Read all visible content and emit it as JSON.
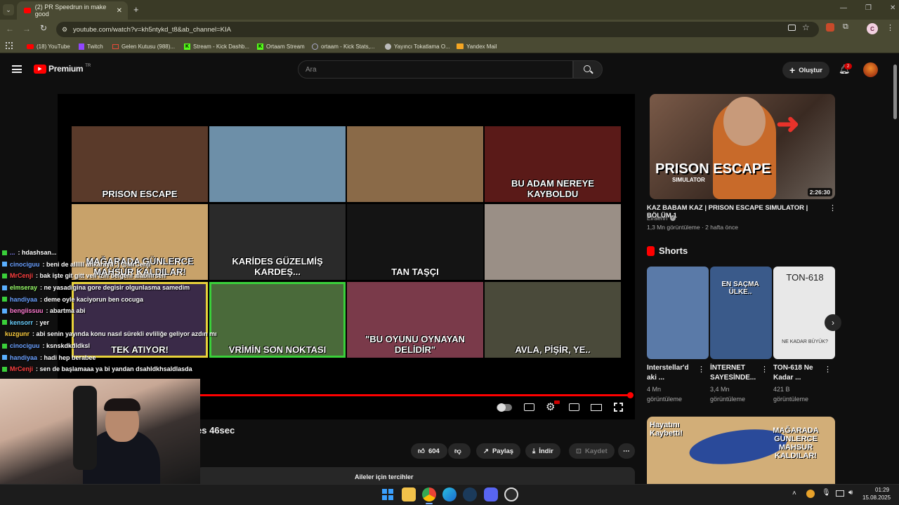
{
  "browser": {
    "tab_title": "(2) PR Speedrun in make good",
    "url": "youtube.com/watch?v=kh5ntykd_t8&ab_channel=KIA",
    "profile_letter": "C",
    "bookmarks": [
      "(18) YouTube",
      "Twitch",
      "Gelen Kutusu (988)...",
      "Stream - Kick Dashb...",
      "Ortaam Stream",
      "ortaam - Kick Stats,...",
      "Yayıncı Tokatlama O...",
      "Yandex Mail"
    ]
  },
  "youtube": {
    "logo": "Premium",
    "logo_sup": "TR",
    "search_placeholder": "Ara",
    "create_label": "Oluştur",
    "notif_count": "2"
  },
  "grid_thumbs": [
    {
      "caption": "PRISON ESCAPE",
      "bg": "#5a3a2a"
    },
    {
      "caption": "",
      "bg": "#6d8fa8"
    },
    {
      "caption": "",
      "bg": "#8a6a48"
    },
    {
      "caption": "BU ADAM NEREYE KAYBOLDU",
      "bg": "#5a1a18"
    },
    {
      "caption": "MAĞARADA GÜNLERCE MAHSUR KALDILAR!",
      "bg": "#c8a26a"
    },
    {
      "caption": "KARİDES GÜZELMİŞ KARDEŞ...",
      "bg": "#2a2a2a"
    },
    {
      "caption": "TAN TAŞÇI",
      "bg": "#141414"
    },
    {
      "caption": "",
      "bg": "#9a8f86"
    },
    {
      "caption": "TEK ATIYOR!",
      "bg": "#3a2a48"
    },
    {
      "caption": "VRİMİN SON NOKTASI",
      "bg": "#4a6a3a"
    },
    {
      "caption": "\"BU OYUNU OYNAYAN DELİDİR\"",
      "bg": "#7a3a4a"
    },
    {
      "caption": "AVLA, PİŞİR, YE..",
      "bg": "#4a4a3a"
    }
  ],
  "chat": [
    {
      "user": "...",
      "text": ": hdashsan...",
      "color": "#8a8aff"
    },
    {
      "user": "cinociguu",
      "text": ": beni de allllll ankaraya :) @MrCenji",
      "color": "#6aa0ff"
    },
    {
      "user": "MrCenji",
      "text": ": bak işte git gitt veli izin belgeni alabilirsen",
      "color": "#ff4040"
    },
    {
      "user": "elmseray",
      "text": ": ne yasadigina gore degisir olgunlasma samedim",
      "color": "#9aff6a"
    },
    {
      "user": "handiyaa",
      "text": ": deme oyle kaciyorun ben cocuga",
      "color": "#6aa0ff"
    },
    {
      "user": "bengiissuu",
      "text": ": abartma abi",
      "color": "#ff7ad0"
    },
    {
      "user": "kensorr",
      "text": ": yer",
      "color": "#6ad0ff"
    },
    {
      "user": "kuzgunr",
      "text": ": abi senin yayında konu nasıl sürekli evliliğe geliyor azdın mı",
      "color": "#ffd040"
    },
    {
      "user": "cinociguu",
      "text": ": ksnskdkdldksl",
      "color": "#6aa0ff"
    },
    {
      "user": "handiyaa",
      "text": ": hadi hep berabee",
      "color": "#6aa0ff"
    },
    {
      "user": "MrCenji",
      "text": ": sen de başlamaaa ya bi yandan dsahldkhsaldlasda",
      "color": "#ff4040"
    }
  ],
  "video": {
    "title_fragment": "es 46sec",
    "likes": "604",
    "share": "Paylaş",
    "download": "İndir",
    "save": "Kaydet",
    "prefs": "Aileler için tercihler"
  },
  "side": {
    "main_title": "KAZ BABAM KAZ | PRISON ESCAPE SIMULATOR | BÖLÜM 1",
    "channel": "Elraenn",
    "meta": "1,3 Mn görüntüleme · 2 hafta önce",
    "duration": "2:26:30",
    "thumb_title": "PRISON ESCAPE",
    "thumb_sub": "SIMULATOR",
    "shorts_label": "Shorts",
    "shorts": [
      {
        "title": "Interstellar'd aki ...",
        "views": "4 Mn",
        "views2": "görüntüleme",
        "bg": "#5a7aa8"
      },
      {
        "title": "İNTERNET SAYESİNDE...",
        "views": "3,4 Mn",
        "views2": "görüntüleme",
        "bg": "#3a5a8a"
      },
      {
        "title": "TON-618 Ne Kadar ...",
        "views": "421 B",
        "views2": "görüntüleme",
        "bg": "#e8e8e8"
      }
    ],
    "shorts_overlays": [
      "EN SAÇMA ÜLKE..",
      "TON-618",
      "NE KADAR BÜYÜK?"
    ],
    "bottom_thumb_text": "MAĞARADA GÜNLERCE MAHSUR KALDILAR!",
    "bottom_thumb_left": "Hayatını Kaybetti!"
  },
  "taskbar": {
    "time": "01:29",
    "date": "15.08.2025"
  }
}
